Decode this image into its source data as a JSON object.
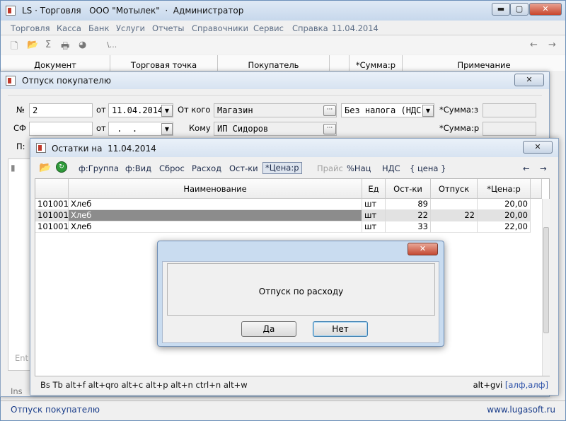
{
  "app": {
    "title": "LS · Торговля   ООО \"Мотылек\"  ·  Администратор",
    "colors": {
      "title_bar": "#c7d8ec",
      "close_button": "#c8452c",
      "selected_row": "#8c8c8c",
      "link_text": "#1a3d8a"
    }
  },
  "window_controls": {
    "minimize": "▬",
    "maximize": "▢",
    "close": "✕"
  },
  "menu": [
    "Торговля",
    "Касса",
    "Банк",
    "Услуги",
    "Отчеты",
    "Справочники",
    "Сервис",
    "Справка",
    "11.04.2014"
  ],
  "toolbar": {
    "icons": [
      "new-doc-icon",
      "open-folder-icon",
      "sigma-icon",
      "printer-icon",
      "pie-chart-icon"
    ],
    "sigma": "Σ",
    "path": "\\...",
    "nav_back": "←",
    "nav_forward": "→"
  },
  "doc_list_header": [
    "Документ",
    "Торговая точка",
    "Покупатель",
    "*Сумма:р",
    "Примечание"
  ],
  "dialog_release": {
    "title": "Отпуск покупателю",
    "close": "✕",
    "no_label": "№",
    "no_value": "2",
    "from_label": "от",
    "date_value": "11.04.2014",
    "from_whom_label": "От кого",
    "from_whom_value": "Магазин",
    "tax_value": "Без налога (НДС)",
    "sum_z_label": "*Сумма:з",
    "sf_label": "СФ",
    "sf_value": "",
    "from2_label": "от",
    "date2_value": " .  .",
    "to_label": "Кому",
    "to_value": "ИП Сидоров",
    "sum_r_label": "*Сумма:р",
    "p_label": "П:",
    "side_label_ent": "Ent",
    "side_label_ins": "Ins",
    "dots": "···",
    "arrow": "▼"
  },
  "dialog_stock": {
    "title": "Остатки на  11.04.2014",
    "close": "✕",
    "toolbar": {
      "group": "ф:Группа",
      "view": "ф:Вид",
      "reset": "Сброс",
      "expense": "Расход",
      "remains": "Ост-ки",
      "price": "*Цена:р",
      "pricelist": "Прайс",
      "markup": "%Нац",
      "vat": "НДС",
      "price_braces": "{ цена }",
      "nav_back": "←",
      "nav_forward": "→"
    },
    "columns": [
      "Наименование",
      "Ед",
      "Ост-ки",
      "Отпуск",
      "*Цена:р"
    ],
    "rows": [
      {
        "code": "101001",
        "name": "Хлеб",
        "unit": "шт",
        "remains": "89",
        "release": "",
        "price": "20,00"
      },
      {
        "code": "101001",
        "name": "Хлеб",
        "unit": "шт",
        "remains": "22",
        "release": "22",
        "price": "20,00"
      },
      {
        "code": "101001",
        "name": "Хлеб",
        "unit": "шт",
        "remains": "33",
        "release": "",
        "price": "22,00"
      }
    ],
    "selected_row": 1,
    "hotkeys": "Bs Tb alt+f alt+qro alt+c alt+p alt+n ctrl+n alt+w",
    "hotkeys_right": "alt+gvi",
    "hotkeys_right_link": "[алф,алф]"
  },
  "confirm": {
    "message": "Отпуск по расходу",
    "yes": "Да",
    "no": "Нет",
    "close": "✕"
  },
  "status": {
    "left": "Отпуск покупателю",
    "right": "www.lugasoft.ru"
  }
}
